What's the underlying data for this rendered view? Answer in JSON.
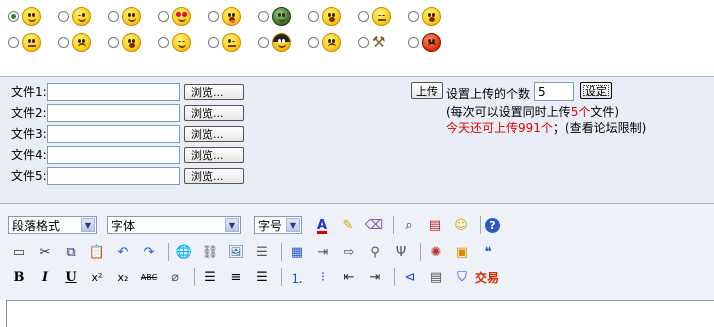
{
  "emoticons": {
    "row1": [
      {
        "icon": "smile-face-icon",
        "selected": true
      },
      {
        "icon": "wink-face-icon",
        "selected": false
      },
      {
        "icon": "grin-face-icon",
        "selected": false
      },
      {
        "icon": "heart-eyes-face-icon",
        "selected": false
      },
      {
        "icon": "tongue-face-icon",
        "selected": false
      },
      {
        "icon": "soldier-face-icon",
        "selected": false
      },
      {
        "icon": "surprised-face-icon",
        "selected": false
      },
      {
        "icon": "sleepy-face-icon",
        "selected": false
      },
      {
        "icon": "shocked-face-icon",
        "selected": false
      }
    ],
    "row2": [
      {
        "icon": "confused-face-icon",
        "selected": false
      },
      {
        "icon": "worried-face-icon",
        "selected": false
      },
      {
        "icon": "crying-face-icon",
        "selected": false
      },
      {
        "icon": "laughing-face-icon",
        "selected": false
      },
      {
        "icon": "smirk-face-icon",
        "selected": false
      },
      {
        "icon": "ninja-face-icon",
        "selected": false
      },
      {
        "icon": "sad-face-icon",
        "selected": false
      },
      {
        "icon": "hammer-icon",
        "selected": false
      },
      {
        "icon": "angry-face-icon",
        "selected": false
      }
    ]
  },
  "upload": {
    "files": [
      {
        "label": "文件1:",
        "value": ""
      },
      {
        "label": "文件2:",
        "value": ""
      },
      {
        "label": "文件3:",
        "value": ""
      },
      {
        "label": "文件4:",
        "value": ""
      },
      {
        "label": "文件5:",
        "value": ""
      }
    ],
    "browse_label": "浏览...",
    "upload_label": "上传",
    "count_label": "设置上传的个数",
    "count_value": "5",
    "set_label": "设定",
    "note1_prefix": "(每次可以设置同时上传",
    "note1_num": "5个",
    "note1_suffix": "文件)",
    "note2_red": "今天还可上传991个",
    "note2_rest": "；(查看论坛限制)"
  },
  "editor": {
    "paragraph_select": "段落格式",
    "font_select": "字体",
    "size_select": "字号",
    "trade_label": "交易",
    "colors": {
      "font_color": "#1a2fd6",
      "highlight": "#ffe600",
      "trade": "#d42a00"
    }
  }
}
